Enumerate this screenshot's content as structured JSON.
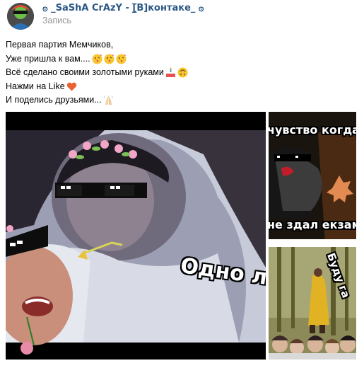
{
  "post": {
    "author": "۞ _SaShA CrAzY - [̲̅В]контаке_ ۞",
    "type_label": "Запись",
    "lines": [
      "Первая партия Мемчиков,",
      "Уже пришла к вам....",
      "Всё сделано своими золотыми руками",
      "Нажми на Like",
      "И поделись друзьями..."
    ]
  },
  "media": {
    "main_caption": "Одно л",
    "top_right_caption_top": "чувство когда",
    "top_right_caption_bottom": "не здал екзаме",
    "bottom_right_caption": "Буду га"
  },
  "icons": {
    "avatar": "avatar",
    "kiss_emoji": "kiss-emoji",
    "cake_emoji": "cake-emoji",
    "upside_down_emoji": "upside-down-face-emoji",
    "heart_emoji": "heart-emoji",
    "praying_hands_emoji": "praying-hands-emoji"
  },
  "colors": {
    "author_link": "#2a5885",
    "muted": "#939393",
    "heart": "#e8632f"
  }
}
